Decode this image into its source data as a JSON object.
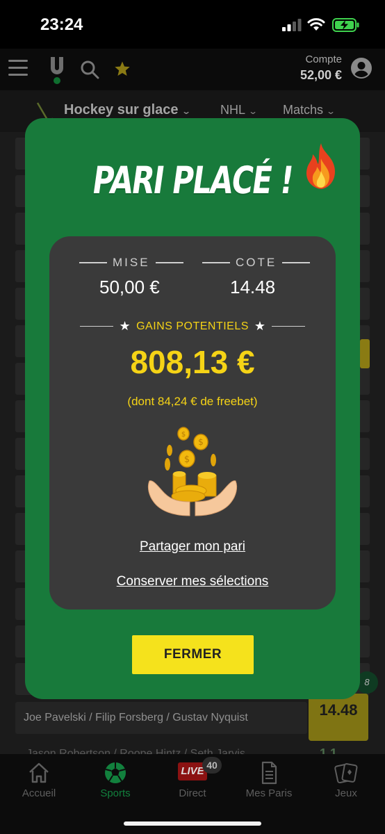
{
  "status_bar": {
    "time": "23:24"
  },
  "header": {
    "account_label": "Compte",
    "balance": "52,00 €"
  },
  "filters": {
    "sport": "Hockey sur glace",
    "league": "NHL",
    "view": "Matchs"
  },
  "background": {
    "scorer_text": "Joe Pavelski / Filip Forsberg / Gustav Nyquist",
    "scorer_odds": "14.48",
    "badge": "8",
    "faint_text": "Jason Robertson / Roope Hintz / Seth Jarvis",
    "faint_odds": "1.1"
  },
  "modal": {
    "title": "PARI PLACÉ !",
    "stake_label": "MISE",
    "stake_value": "50,00 €",
    "odds_label": "COTE",
    "odds_value": "14.48",
    "gains_label": "GAINS POTENTIELS",
    "gains_value": "808,13 €",
    "freebet_note": "(dont 84,24 € de freebet)",
    "share_link": "Partager mon pari",
    "keep_link": "Conserver mes sélections",
    "close_button": "FERMER"
  },
  "bottom_nav": {
    "items": [
      {
        "label": "Accueil",
        "icon": "home-icon"
      },
      {
        "label": "Sports",
        "icon": "soccer-ball-icon",
        "active": true
      },
      {
        "label": "Direct",
        "icon": "live-icon",
        "badge": "LIVE",
        "count": "40"
      },
      {
        "label": "Mes Paris",
        "icon": "document-icon"
      },
      {
        "label": "Jeux",
        "icon": "cards-icon"
      }
    ]
  },
  "colors": {
    "modal_green": "#187a3b",
    "accent_yellow": "#f5d316",
    "button_yellow": "#f5e21c",
    "card_gray": "#3a3a3a"
  }
}
